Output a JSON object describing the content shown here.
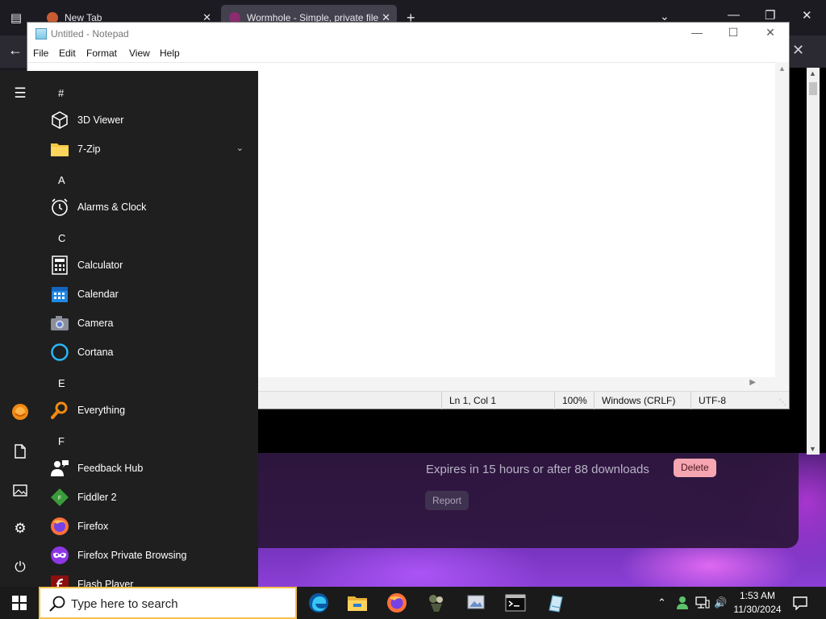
{
  "browser": {
    "tabs": [
      {
        "title": "New Tab",
        "active": false
      },
      {
        "title": "Wormhole - Simple, private file",
        "active": true
      }
    ],
    "page": {
      "expires_text": "Expires in 15 hours or after 88 downloads",
      "delete_label": "Delete",
      "report_label": "Report"
    }
  },
  "notepad": {
    "title": "Untitled - Notepad",
    "menu": [
      "File",
      "Edit",
      "Format",
      "View",
      "Help"
    ],
    "status": {
      "position": "Ln 1, Col 1",
      "zoom": "100%",
      "line_endings": "Windows (CRLF)",
      "encoding": "UTF-8"
    }
  },
  "start_menu": {
    "sections": [
      {
        "header": "#",
        "items": [
          {
            "label": "3D Viewer",
            "icon": "cube-icon"
          },
          {
            "label": "7-Zip",
            "icon": "folder-icon",
            "expandable": true
          }
        ]
      },
      {
        "header": "A",
        "items": [
          {
            "label": "Alarms & Clock",
            "icon": "alarm-clock-icon"
          }
        ]
      },
      {
        "header": "C",
        "items": [
          {
            "label": "Calculator",
            "icon": "calculator-icon"
          },
          {
            "label": "Calendar",
            "icon": "calendar-icon"
          },
          {
            "label": "Camera",
            "icon": "camera-icon"
          },
          {
            "label": "Cortana",
            "icon": "cortana-icon"
          }
        ]
      },
      {
        "header": "E",
        "items": [
          {
            "label": "Everything",
            "icon": "magnifier-icon"
          }
        ]
      },
      {
        "header": "F",
        "items": [
          {
            "label": "Feedback Hub",
            "icon": "feedback-icon"
          },
          {
            "label": "Fiddler 2",
            "icon": "fiddler-icon"
          },
          {
            "label": "Firefox",
            "icon": "firefox-icon"
          },
          {
            "label": "Firefox Private Browsing",
            "icon": "firefox-private-icon"
          },
          {
            "label": "Flash Player",
            "icon": "flash-icon"
          }
        ]
      }
    ]
  },
  "taskbar": {
    "search_placeholder": "Type here to search",
    "apps": [
      "edge-icon",
      "file-explorer-icon",
      "firefox-icon",
      "app-icon",
      "photos-icon",
      "terminal-icon",
      "paint-icon"
    ],
    "clock_time": "1:53 AM",
    "clock_date": "11/30/2024"
  },
  "colors": {
    "start_menu_bg": "#1f1f1f",
    "taskbar_bg": "#1a1a1a",
    "delete_button": "#f5a6b0",
    "search_border": "#f2c14a"
  }
}
